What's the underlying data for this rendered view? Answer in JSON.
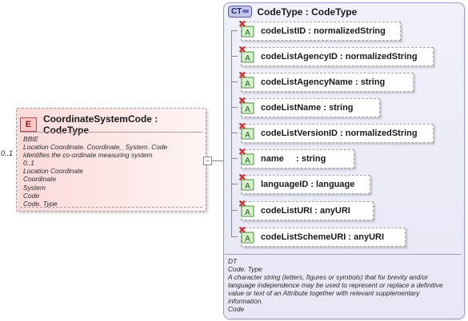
{
  "element": {
    "badge": "E",
    "title": "CoordinateSystemCode : CodeType",
    "occurrence": "0..1",
    "doc": [
      "BBIE",
      "Location Coordinate. Coordinate_ System. Code",
      "identifies the co-ordinate measuring system",
      "0..1",
      "Location Coordinate",
      "Coordinate",
      "System",
      "Code",
      "Code. Type"
    ]
  },
  "collapse_symbol": "−",
  "complex_type": {
    "badge": "CT",
    "title": "CodeType : CodeType",
    "attributes": [
      {
        "label": "codeListID : normalizedString"
      },
      {
        "label": "codeListAgencyID : normalizedString"
      },
      {
        "label": "codeListAgencyName : string"
      },
      {
        "label": "codeListName : string"
      },
      {
        "label": "codeListVersionID : normalizedString"
      },
      {
        "label": "name     : string"
      },
      {
        "label": "languageID : language"
      },
      {
        "label": "codeListURI : anyURI"
      },
      {
        "label": "codeListSchemeURI : anyURI"
      }
    ],
    "attribute_icon": "attribute-A-with-red-x-icon",
    "doc": [
      "DT",
      "Code. Type",
      "A character string (letters, figures or symbols) that for brevity and/or",
      "language independence may be used to represent or replace a definitive",
      "value or text of an Attribute together with relevant supplementary",
      "information.",
      "Code"
    ]
  },
  "colors": {
    "element_fill": "#fbdada",
    "element_badge": "#f7c9c9",
    "type_panel": "#e7e7f6",
    "attribute_badge": "#d8f2d0",
    "error_mark": "#d42a2a"
  }
}
